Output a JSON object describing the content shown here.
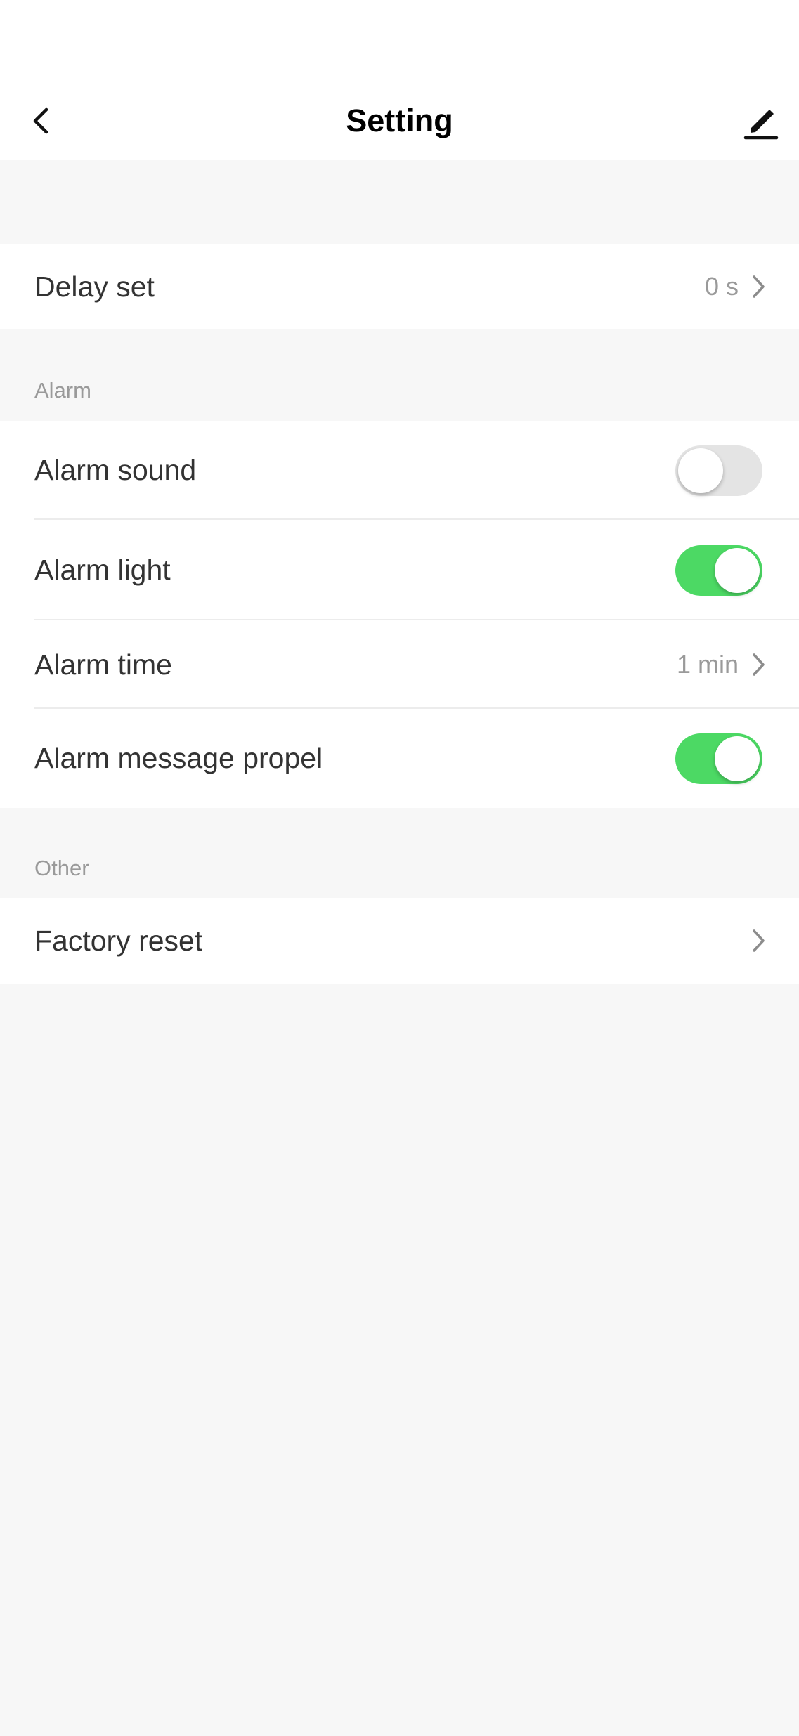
{
  "header": {
    "title": "Setting",
    "back_icon": "chevron-left-icon",
    "edit_icon": "pencil-icon"
  },
  "general": {
    "delay_set": {
      "label": "Delay set",
      "value": "0 s"
    }
  },
  "alarm": {
    "section_title": "Alarm",
    "sound": {
      "label": "Alarm sound",
      "enabled": false
    },
    "light": {
      "label": "Alarm light",
      "enabled": true
    },
    "time": {
      "label": "Alarm time",
      "value": "1 min"
    },
    "message_propel": {
      "label": "Alarm message propel",
      "enabled": true
    }
  },
  "other": {
    "section_title": "Other",
    "factory_reset": {
      "label": "Factory reset"
    }
  },
  "colors": {
    "toggle_on": "#4cd964",
    "toggle_off": "#e4e4e4",
    "background": "#f7f7f7"
  }
}
